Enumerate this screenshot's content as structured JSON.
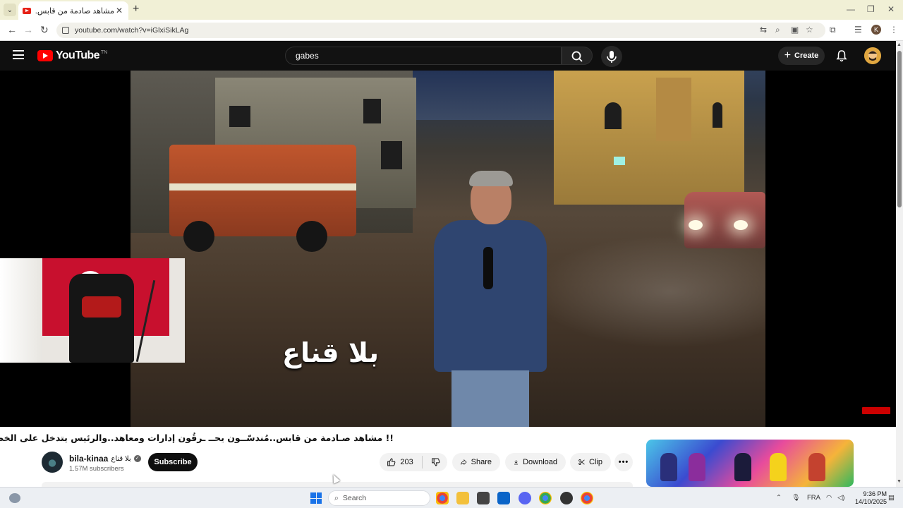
{
  "browser": {
    "tab_title": "مشاهد صادمة من قابس..",
    "url": "youtube.com/watch?v=iGlxiSikLAg",
    "profile_initial": "K"
  },
  "header": {
    "logo_text": "YouTube",
    "logo_region": "TN",
    "search_value": "gabes",
    "create_label": "Create"
  },
  "player": {
    "caption": "بلا قناع"
  },
  "video": {
    "title": "!! مشاهد صـادمة من قابس..مُندسّــون يحــ ـرقُون إدارات ومعاهد..والرئيس يتدخل على الخط بصرامة",
    "channel_name": "bila-kinaa",
    "channel_name_ar": "بلا قناع",
    "subscribers": "1.57M subscribers",
    "subscribe_label": "Subscribe",
    "likes": "203",
    "share_label": "Share",
    "download_label": "Download",
    "clip_label": "Clip"
  },
  "taskbar": {
    "search_placeholder": "Search",
    "language": "FRA",
    "time": "9:36 PM",
    "date": "14/10/2025"
  },
  "colors": {
    "youtube_red": "#ff0000",
    "header_bg": "#0f0f0f",
    "tab_strip": "#f1f0d6"
  }
}
